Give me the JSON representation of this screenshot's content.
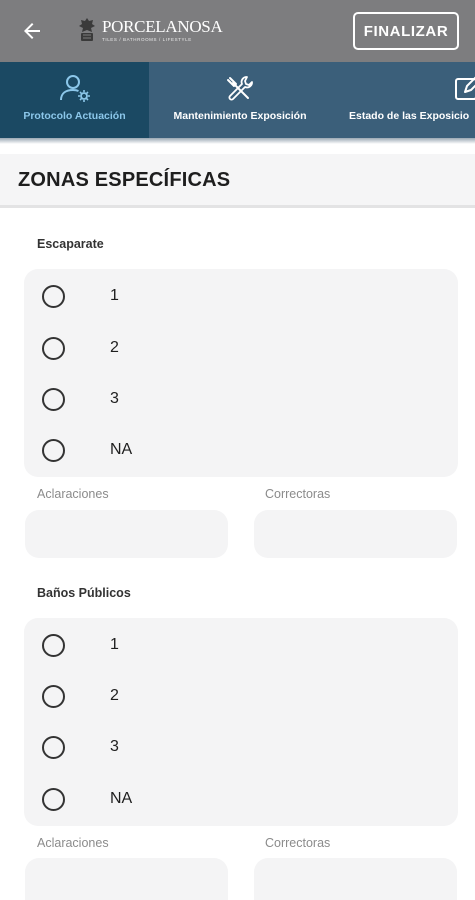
{
  "appbar": {
    "logo_text": "PORCELANOSA",
    "logo_tagline": "TILES / BATHROOMS / LIFESTYLE",
    "finalize_label": "FINALIZAR"
  },
  "tabs": [
    {
      "label": "Protocolo Actuación",
      "icon": "user-settings-icon",
      "active": true
    },
    {
      "label": "Mantenimiento Exposición",
      "icon": "tools-icon",
      "active": false
    },
    {
      "label": "Estado de las Exposicio",
      "icon": "edit-icon",
      "active": false
    }
  ],
  "section": {
    "title": "ZONAS ESPECÍFICAS"
  },
  "groups": [
    {
      "label": "Escaparate",
      "options": [
        "1",
        "2",
        "3",
        "NA"
      ],
      "aclaraciones_label": "Aclaraciones",
      "correctoras_label": "Correctoras",
      "aclaraciones_value": "",
      "correctoras_value": ""
    },
    {
      "label": "Baños Públicos",
      "options": [
        "1",
        "2",
        "3",
        "NA"
      ],
      "aclaraciones_label": "Aclaraciones",
      "correctoras_label": "Correctoras",
      "aclaraciones_value": "",
      "correctoras_value": ""
    }
  ],
  "colors": {
    "appbar": "#7d7d7f",
    "tabbar": "#3b5f7a",
    "tab_active": "#1b4963",
    "tab_active_text": "#8cc7ea"
  }
}
